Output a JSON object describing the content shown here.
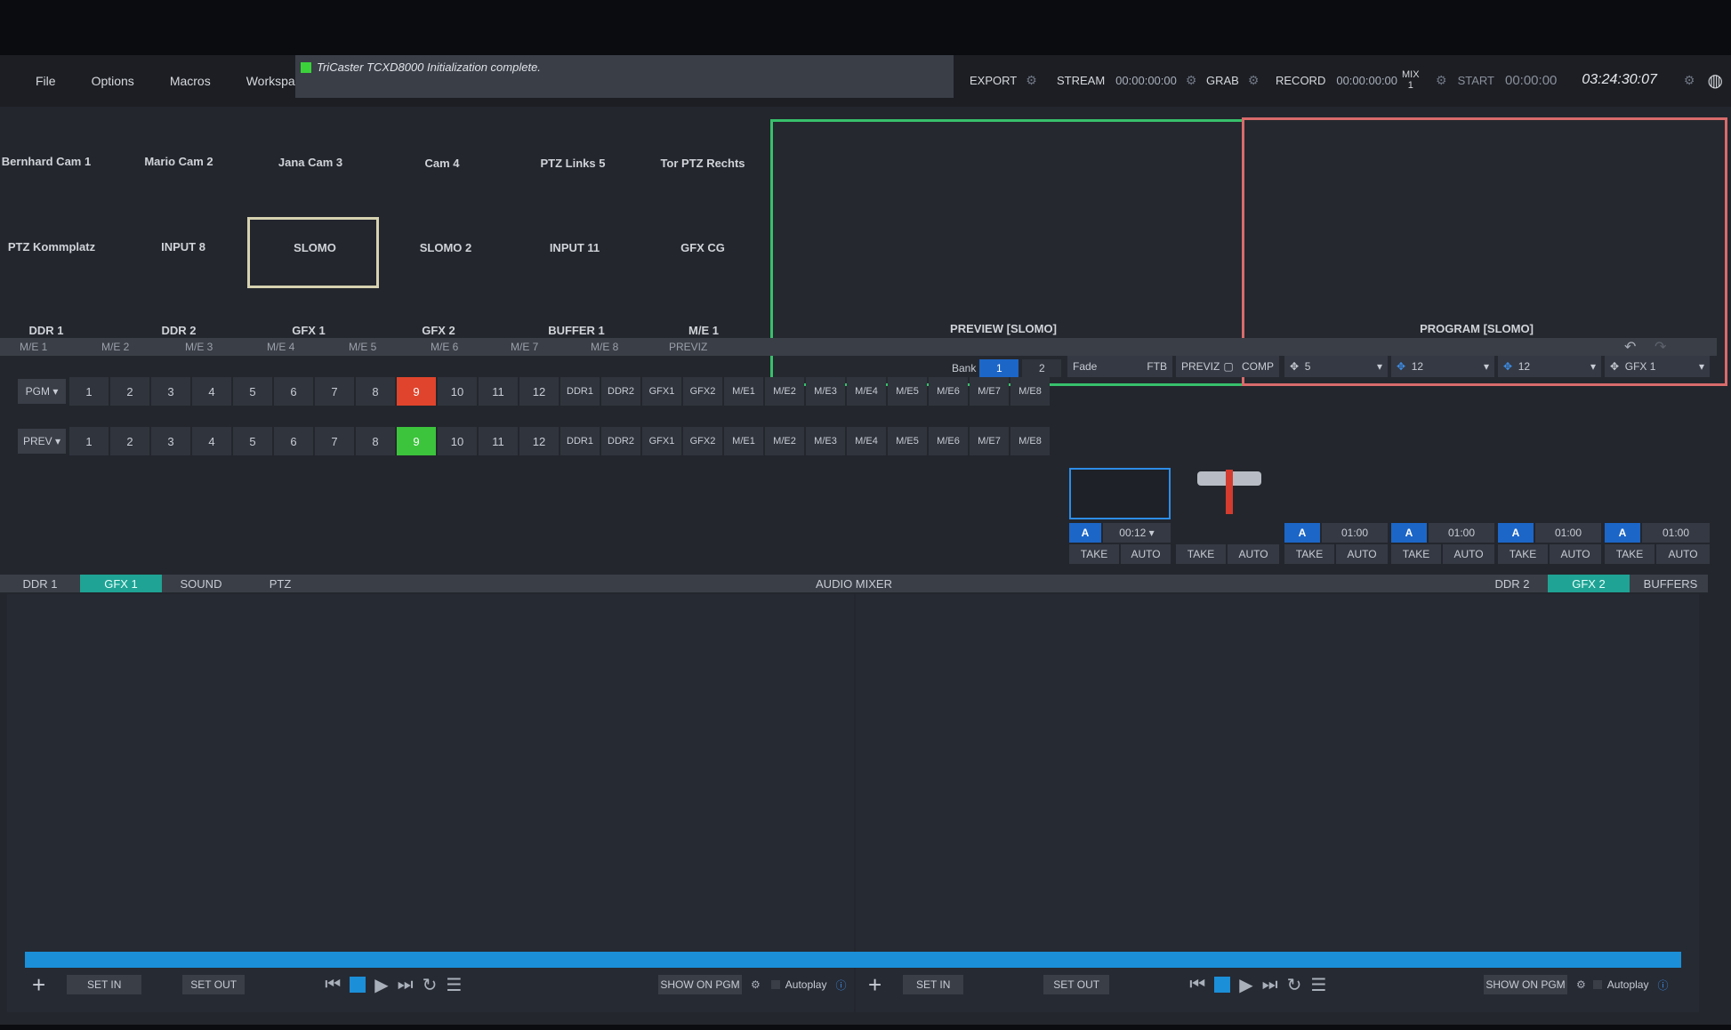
{
  "menu": [
    "File",
    "Options",
    "Macros",
    "Workspaces"
  ],
  "status_message": "TriCaster TCXD8000 Initialization complete.",
  "toolbar": {
    "export": "EXPORT",
    "stream": "STREAM",
    "stream_time": "00:00:00:00",
    "grab": "GRAB",
    "record": "RECORD",
    "record_time": "00:00:00:00",
    "mix_label": "MIX",
    "mix_num": "1",
    "start": "START",
    "start_time": "00:00:00",
    "clock": "03:24:30:07"
  },
  "multiview": {
    "row1": [
      "Bernhard Cam 1",
      "Mario Cam 2",
      "Jana Cam 3",
      "Cam 4",
      "PTZ Links 5",
      "Tor PTZ Rechts"
    ],
    "row2": [
      "PTZ Kommplatz",
      "INPUT 8",
      "SLOMO",
      "SLOMO 2",
      "INPUT 11",
      "GFX CG"
    ],
    "row3": [
      "DDR 1",
      "DDR 2",
      "GFX 1",
      "GFX 2",
      "BUFFER 1",
      "M/E 1"
    ],
    "preview_label": "PREVIEW [SLOMO]",
    "program_label": "PROGRAM [SLOMO]"
  },
  "me_strip": [
    "M/E 1",
    "M/E 2",
    "M/E 3",
    "M/E 4",
    "M/E 5",
    "M/E 6",
    "M/E 7",
    "M/E 8",
    "PREVIZ"
  ],
  "switcher": {
    "bank_label": "Bank",
    "banks": [
      "1",
      "2"
    ],
    "pgm_label": "PGM",
    "prev_label": "PREV",
    "numbers": [
      "1",
      "2",
      "3",
      "4",
      "5",
      "6",
      "7",
      "8",
      "9",
      "10",
      "11",
      "12"
    ],
    "sources": [
      [
        "DDR",
        "1"
      ],
      [
        "DDR",
        "2"
      ],
      [
        "GFX",
        "1"
      ],
      [
        "GFX",
        "2"
      ],
      [
        "M/E",
        "1"
      ],
      [
        "M/E",
        "2"
      ],
      [
        "M/E",
        "3"
      ],
      [
        "M/E",
        "4"
      ],
      [
        "M/E",
        "5"
      ],
      [
        "M/E",
        "6"
      ],
      [
        "M/E",
        "7"
      ],
      [
        "M/E",
        "8"
      ]
    ],
    "pgm_active": "9",
    "prev_active": "9"
  },
  "transition": {
    "fade": "Fade",
    "ftb": "FTB",
    "previz": "PREVIZ",
    "comp": "COMP",
    "dsk": [
      "5",
      "12",
      "12",
      "GFX 1"
    ],
    "duration": "00:12",
    "dsk_durations": [
      "01:00",
      "01:00",
      "01:00",
      "01:00"
    ],
    "take": "TAKE",
    "auto": "AUTO"
  },
  "tabs_left": [
    "DDR 1",
    "GFX 1",
    "SOUND",
    "PTZ"
  ],
  "audio_mixer": "AUDIO MIXER",
  "tabs_right": [
    "DDR 2",
    "GFX 2",
    "BUFFERS"
  ],
  "controls": {
    "set_in": "SET IN",
    "set_out": "SET OUT",
    "show_on_pgm": "SHOW ON PGM",
    "autoplay": "Autoplay"
  }
}
